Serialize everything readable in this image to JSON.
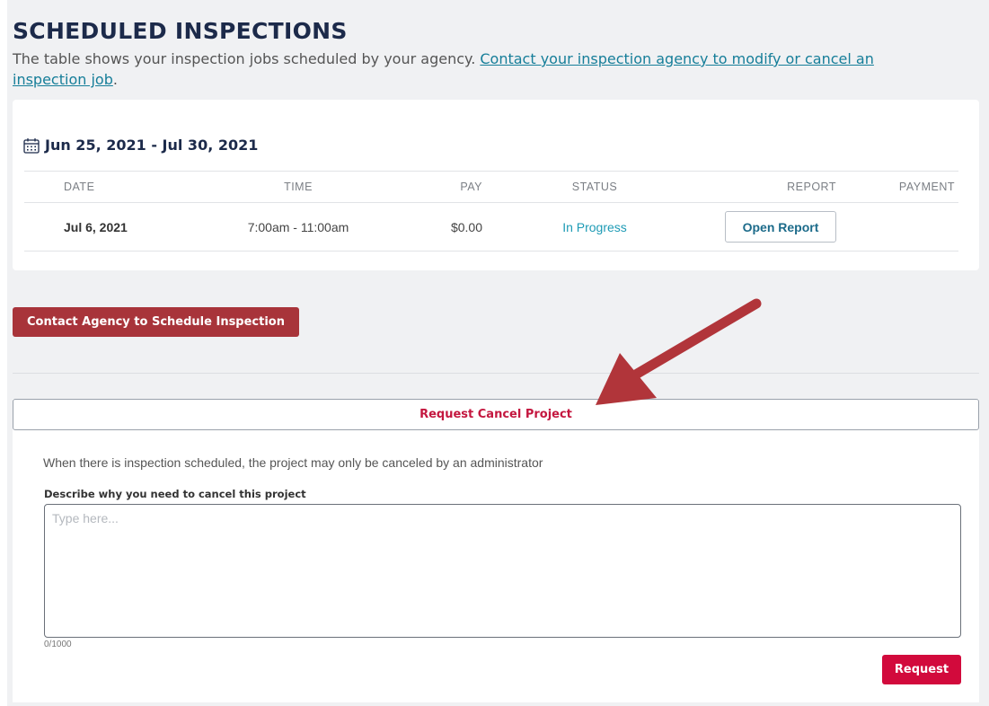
{
  "header": {
    "title": "SCHEDULED INSPECTIONS",
    "subtitle_text": "The table shows your inspection jobs scheduled by your agency. ",
    "subtitle_link": "Contact your inspection agency to modify or cancel an inspection job",
    "subtitle_end": "."
  },
  "schedule": {
    "date_range": "Jun 25, 2021 - Jul 30, 2021",
    "columns": [
      "DATE",
      "TIME",
      "PAY",
      "STATUS",
      "REPORT",
      "PAYMENT"
    ],
    "rows": [
      {
        "date": "Jul 6, 2021",
        "time": "7:00am - 11:00am",
        "pay": "$0.00",
        "status": "In Progress",
        "report_button": "Open Report",
        "payment": ""
      }
    ]
  },
  "actions": {
    "contact_button": "Contact Agency to Schedule Inspection"
  },
  "cancel": {
    "header": "Request Cancel Project",
    "notice": "When there is inspection scheduled, the project may only be canceled by an administrator",
    "field_label": "Describe why you need to cancel this project",
    "placeholder": "Type here...",
    "value": "",
    "counter": "0/1000",
    "submit_button": "Request"
  },
  "colors": {
    "title": "#1c2a4a",
    "link": "#167e99",
    "status": "#1e9bb5",
    "contact_button": "#a8343a",
    "cancel_accent": "#c4173f",
    "request_button": "#d20a3c",
    "annotation_arrow": "#b1353a"
  },
  "icons": {
    "date_range": "calendar-icon"
  }
}
